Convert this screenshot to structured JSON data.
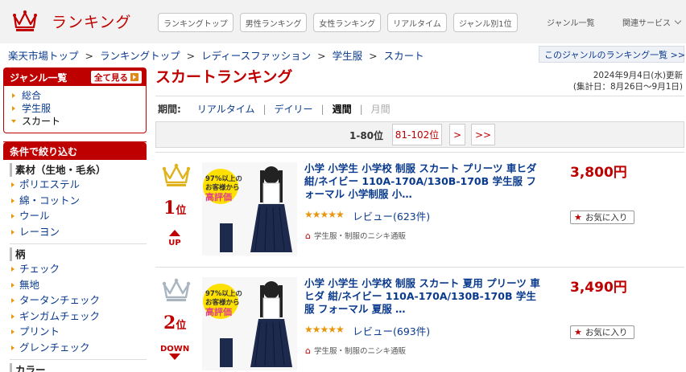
{
  "header": {
    "logo_text": "ランキング",
    "nav_pills": [
      "ランキングトップ",
      "男性ランキング",
      "女性ランキング",
      "リアルタイム",
      "ジャンル別1位"
    ],
    "genre_list": "ジャンル一覧",
    "related": "関連サービス"
  },
  "breadcrumb": [
    "楽天市場トップ",
    "ランキングトップ",
    "レディースファッション",
    "学生服",
    "スカート"
  ],
  "genre_ranking_link": "このジャンルのランキング一覧 >>",
  "sidebar": {
    "genre_title": "ジャンル一覧",
    "see_all": "全て見る",
    "genre_items": [
      "総合",
      "学生服",
      "スカート"
    ],
    "filter_title": "条件で絞り込む",
    "material_title": "素材（生地・毛糸）",
    "materials": [
      "ポリエステル",
      "綿・コットン",
      "ウール",
      "レーヨン"
    ],
    "pattern_title": "柄",
    "patterns": [
      "チェック",
      "無地",
      "タータンチェック",
      "ギンガムチェック",
      "プリント",
      "グレンチェック"
    ],
    "color_title": "カラー"
  },
  "main": {
    "title": "スカートランキング",
    "updated": "2024年9月4日(水)更新",
    "period_range": "(集計日：8月26日〜9月1日)",
    "period_label": "期間:",
    "periods": [
      "リアルタイム",
      "デイリー",
      "週間",
      "月間"
    ],
    "pager": {
      "current": "1-80位",
      "next": "81-102位",
      "single": ">",
      "double": ">>"
    }
  },
  "items": [
    {
      "rank": "1",
      "rank_suffix": "位",
      "movement": "UP",
      "name": "小学 小学生 小学校 制服 スカート プリーツ 車ヒダ 紺/ネイビー 110A-170A/130B-170B 学生服 フォーマル 小学制服 小…",
      "stars": "★★★★★",
      "review": "レビュー(623件)",
      "shop": "学生服・制服のニシキ通販",
      "price": "3,800円",
      "fav": "お気に入り",
      "thumb_badge": [
        "97%以上の",
        "お客様から",
        "高評価"
      ]
    },
    {
      "rank": "2",
      "rank_suffix": "位",
      "movement": "DOWN",
      "name": "小学 小学生 小学校 制服 スカート 夏用 プリーツ 車ヒダ 紺/ネイビー 110A-170A/130B-170B 学生服 フォーマル 夏服 …",
      "stars": "★★★★★",
      "review": "レビュー(693件)",
      "shop": "学生服・制服のニシキ通販",
      "price": "3,490円",
      "fav": "お気に入り",
      "thumb_badge": [
        "97%以上の",
        "お客様から",
        "高評価"
      ]
    }
  ],
  "colors": {
    "brand": "#bf0000",
    "link": "#0a3a8c",
    "accent": "#e8960c"
  }
}
